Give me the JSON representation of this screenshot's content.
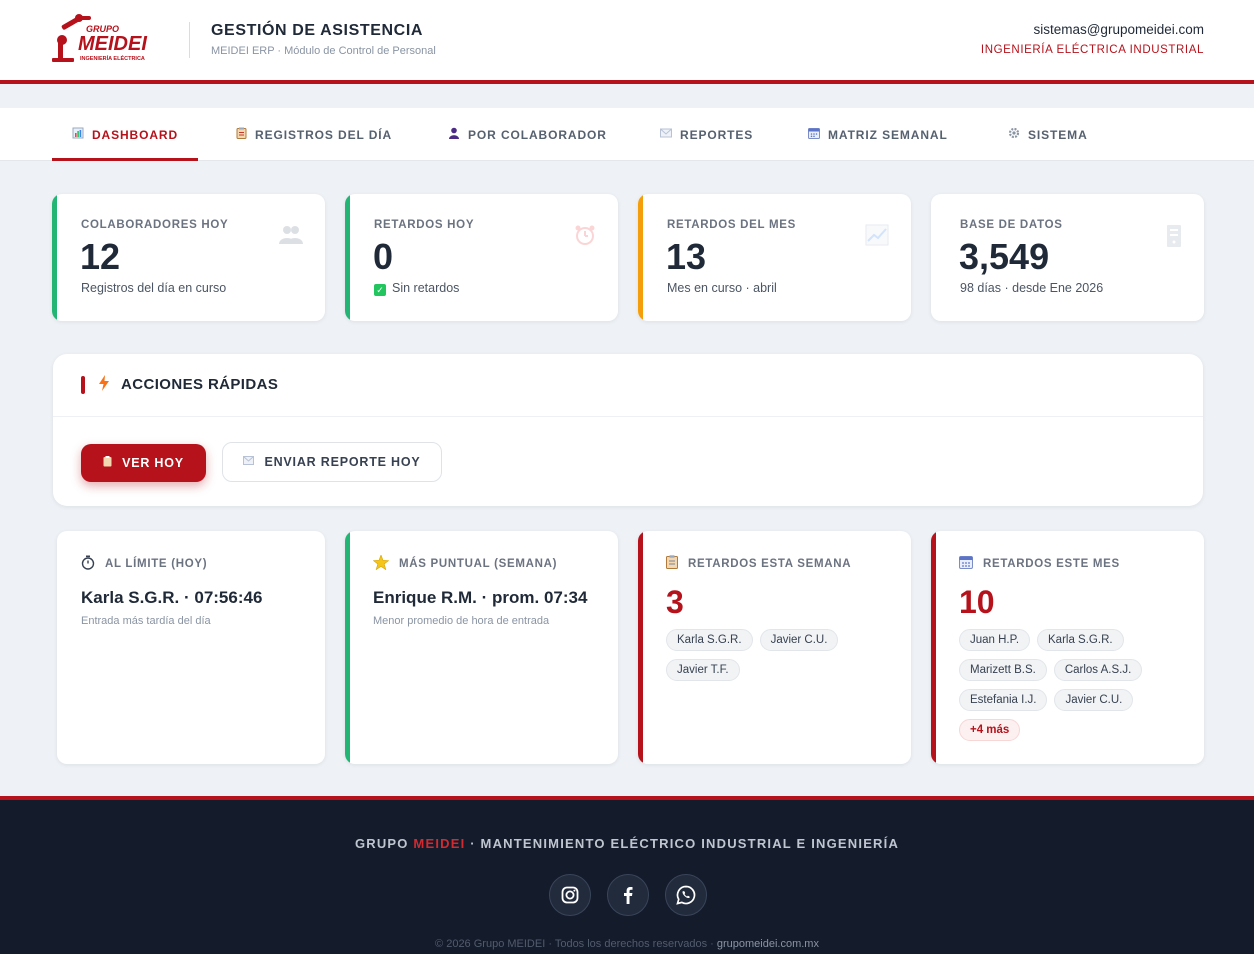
{
  "header": {
    "logo": {
      "top": "GRUPO",
      "brand": "MEIDEI",
      "tagline": "INGENIERÍA ELÉCTRICA"
    },
    "title": "GESTIÓN DE ASISTENCIA",
    "subtitle": "MEIDEI ERP · Módulo de Control de Personal",
    "email": "sistemas@grupomeidei.com",
    "company": "INGENIERÍA ELÉCTRICA INDUSTRIAL"
  },
  "nav": {
    "tabs": [
      {
        "label": "DASHBOARD",
        "icon": "chart-icon",
        "active": true
      },
      {
        "label": "REGISTROS DEL DÍA",
        "icon": "clipboard-icon"
      },
      {
        "label": "POR COLABORADOR",
        "icon": "user-icon"
      },
      {
        "label": "REPORTES",
        "icon": "mail-icon"
      },
      {
        "label": "MATRIZ SEMANAL",
        "icon": "calendar-icon"
      },
      {
        "label": "SISTEMA",
        "icon": "gear-icon"
      }
    ]
  },
  "stats": [
    {
      "label": "COLABORADORES HOY",
      "value": "12",
      "sub": "Registros del día en curso",
      "color": "#22b573",
      "icon": "people-icon"
    },
    {
      "label": "RETARDOS HOY",
      "value": "0",
      "sub": "Sin retardos",
      "color": "#22b573",
      "icon": "alarm-clock-icon"
    },
    {
      "label": "RETARDOS DEL MES",
      "value": "13",
      "sub": "Mes en curso · abril",
      "color": "#f59e0b",
      "icon": "trend-chart-icon"
    },
    {
      "label": "BASE DE DATOS",
      "value": "3,549",
      "sub": "98 días · desde Ene 2026",
      "icon": "database-icon"
    }
  ],
  "quick_actions": {
    "title": "ACCIONES RÁPIDAS",
    "primary": "VER HOY",
    "secondary": "ENVIAR REPORTE HOY"
  },
  "info": {
    "al_limite": {
      "title": "AL LÍMITE (HOY)",
      "name": "Karla S.G.R. · 07:56:46",
      "desc": "Entrada más tardía del día",
      "color": "#ffffff"
    },
    "puntual": {
      "title": "MÁS PUNTUAL (SEMANA)",
      "name": "Enrique R.M. · prom. 07:34",
      "desc": "Menor promedio de hora de entrada",
      "color": "#22b573"
    },
    "semana": {
      "title": "RETARDOS ESTA SEMANA",
      "count": "3",
      "names": [
        "Karla S.G.R.",
        "Javier C.U.",
        "Javier T.F."
      ],
      "color": "#b5121b"
    },
    "mes": {
      "title": "RETARDOS ESTE MES",
      "count": "10",
      "names": [
        "Juan H.P.",
        "Karla S.G.R.",
        "Marizett B.S.",
        "Carlos A.S.J.",
        "Estefania I.J.",
        "Javier C.U."
      ],
      "more": "+4 más",
      "color": "#b5121b"
    }
  },
  "footer": {
    "brand_a": "GRUPO ",
    "brand_b": "MEIDEI",
    "brand_c": " · MANTENIMIENTO ELÉCTRICO INDUSTRIAL E INGENIERÍA",
    "socials": [
      "instagram-icon",
      "facebook-icon",
      "whatsapp-icon"
    ],
    "copyright": "© 2026 Grupo MEIDEI · Todos los derechos reservados · ",
    "site": "grupomeidei.com.mx"
  },
  "colors": {
    "brand": "#b5121b",
    "footer_bg": "#141b2b",
    "success": "#22b573",
    "warning": "#f59e0b"
  }
}
